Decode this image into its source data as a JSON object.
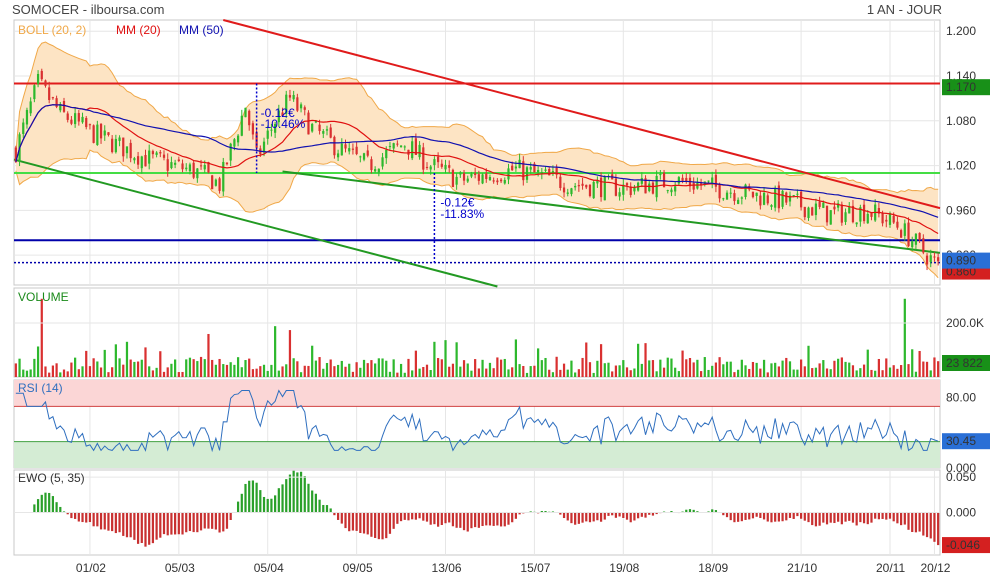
{
  "header": {
    "symbol_source": "SOMOCER - ilboursa.com",
    "period": "1 AN - JOUR"
  },
  "colors": {
    "up": "#2db82d",
    "down": "#d93030",
    "boll": "#f0a848",
    "boll_fill": "#fde4c4",
    "mm20": "#e01010",
    "mm50": "#1010b0",
    "rsi": "#2f6fbf",
    "ewo_up": "#2aa02a",
    "ewo_down": "#c83030",
    "green_line": "#229922",
    "red_line": "#e01b1b",
    "support_blue": "#0000aa",
    "badge_blue": "#2a6fd6",
    "badge_green": "#189018",
    "badge_red": "#d42020"
  },
  "chart_data": [
    {
      "id": "price",
      "type": "candlestick",
      "legend": [
        {
          "label": "BOLL (20, 2)",
          "color": "#f0a848"
        },
        {
          "label": "MM (20)",
          "color": "#e01010"
        },
        {
          "label": "MM (50)",
          "color": "#1010b0"
        }
      ],
      "ylim": [
        0.86,
        1.215
      ],
      "y_ticks": [
        "1.200",
        "1.140",
        "1.080",
        "1.020",
        "0.960",
        "0.900"
      ],
      "y_tick_values": [
        1.2,
        1.14,
        1.08,
        1.02,
        0.96,
        0.9
      ],
      "last_close": "1.170",
      "current_price": "0.890",
      "bottom_badge": "0.860",
      "support_level": 0.89,
      "resistance_level": 1.13,
      "green_level": 1.01,
      "blue_level": 0.92,
      "annotations": [
        {
          "text1": "-0.12€",
          "text2": "-10.46%"
        },
        {
          "text1": "-0.12€",
          "text2": "-11.83%"
        }
      ]
    },
    {
      "id": "volume",
      "type": "bar",
      "title": "VOLUME",
      "y_ticks": [
        "200.0K"
      ],
      "y_tick_values": [
        200000
      ],
      "ylim": [
        0,
        330000
      ],
      "last_value": "23 822"
    },
    {
      "id": "rsi",
      "type": "line",
      "title": "RSI (14)",
      "y_ticks": [
        "80.00",
        "0.000"
      ],
      "y_tick_values": [
        80,
        0
      ],
      "ylim": [
        0,
        100
      ],
      "upper_band": 70,
      "lower_band": 30,
      "last_value": "30.45"
    },
    {
      "id": "ewo",
      "type": "bar",
      "title": "EWO (5, 35)",
      "y_ticks": [
        "0.050",
        "0.000"
      ],
      "y_tick_values": [
        0.05,
        0
      ],
      "ylim": [
        -0.06,
        0.06
      ],
      "last_value": "-0.046"
    }
  ],
  "x_axis": {
    "labels": [
      "01/02",
      "05/03",
      "05/04",
      "09/05",
      "13/06",
      "15/07",
      "19/08",
      "18/09",
      "21/10",
      "20/11",
      "20/12"
    ]
  }
}
